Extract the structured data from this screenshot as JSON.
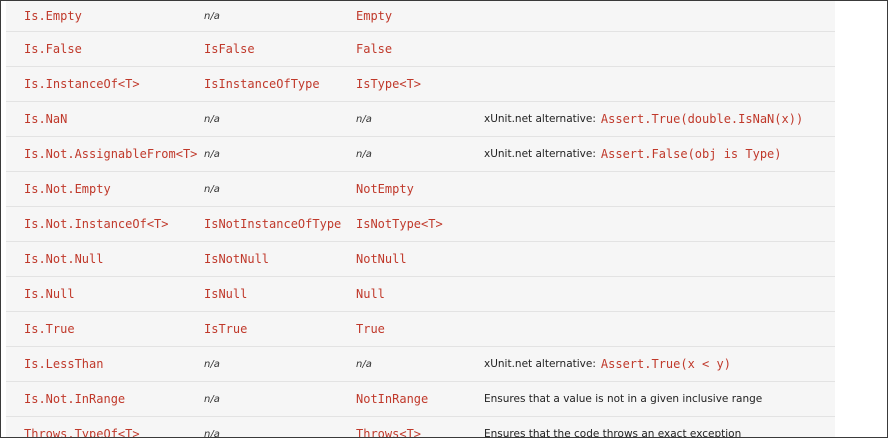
{
  "rows": [
    {
      "nunit": "Is.Empty",
      "mstest": "n/a",
      "xunit": "Empty",
      "note_text": "",
      "note_code": ""
    },
    {
      "nunit": "Is.False",
      "mstest": "IsFalse",
      "xunit": "False",
      "note_text": "",
      "note_code": ""
    },
    {
      "nunit": "Is.InstanceOf<T>",
      "mstest": "IsInstanceOfType",
      "xunit": "IsType<T>",
      "note_text": "",
      "note_code": ""
    },
    {
      "nunit": "Is.NaN",
      "mstest": "n/a",
      "xunit": "n/a",
      "note_text": "xUnit.net alternative:",
      "note_code": "Assert.True(double.IsNaN(x))"
    },
    {
      "nunit": "Is.Not.AssignableFrom<T>",
      "mstest": "n/a",
      "xunit": "n/a",
      "note_text": "xUnit.net alternative:",
      "note_code": "Assert.False(obj is Type)"
    },
    {
      "nunit": "Is.Not.Empty",
      "mstest": "n/a",
      "xunit": "NotEmpty",
      "note_text": "",
      "note_code": ""
    },
    {
      "nunit": "Is.Not.InstanceOf<T>",
      "mstest": "IsNotInstanceOfType",
      "xunit": "IsNotType<T>",
      "note_text": "",
      "note_code": ""
    },
    {
      "nunit": "Is.Not.Null",
      "mstest": "IsNotNull",
      "xunit": "NotNull",
      "note_text": "",
      "note_code": ""
    },
    {
      "nunit": "Is.Null",
      "mstest": "IsNull",
      "xunit": "Null",
      "note_text": "",
      "note_code": ""
    },
    {
      "nunit": "Is.True",
      "mstest": "IsTrue",
      "xunit": "True",
      "note_text": "",
      "note_code": ""
    },
    {
      "nunit": "Is.LessThan",
      "mstest": "n/a",
      "xunit": "n/a",
      "note_text": "xUnit.net alternative:",
      "note_code": "Assert.True(x < y)"
    },
    {
      "nunit": "Is.Not.InRange",
      "mstest": "n/a",
      "xunit": "NotInRange",
      "note_text": "Ensures that a value is not in a given inclusive range",
      "note_code": ""
    },
    {
      "nunit": "Throws.TypeOf<T>",
      "mstest": "n/a",
      "xunit": "Throws<T>",
      "note_text": "Ensures that the code throws an exact exception",
      "note_code": ""
    }
  ]
}
